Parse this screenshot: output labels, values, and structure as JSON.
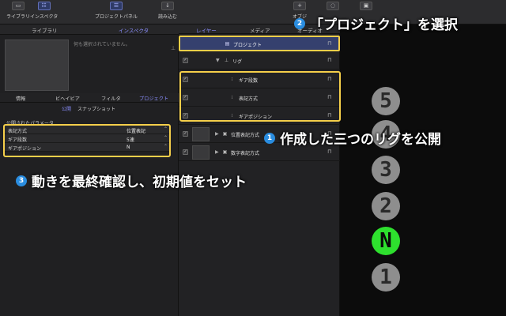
{
  "toolbar": {
    "buttons": [
      {
        "label": "ライブラリ",
        "icon": "library-icon"
      },
      {
        "label": "インスペクタ",
        "icon": "inspector-icon"
      },
      {
        "label": "プロジェクトパネル",
        "icon": "project-panel-icon"
      },
      {
        "label": "読み込む",
        "icon": "import-icon"
      },
      {
        "label": "オブジ",
        "icon": "add-object-icon"
      },
      {
        "label": "",
        "icon": "behaviors-icon"
      },
      {
        "label": "",
        "icon": "shape-icon"
      }
    ]
  },
  "left_panel": {
    "tabs": [
      "ライブラリ",
      "インスペクタ"
    ],
    "active_tab": "インスペクタ",
    "preview_message": "何も選択されていません。",
    "inspector_tabs": [
      "情報",
      "ビヘイビア",
      "フィルタ",
      "プロジェクト"
    ],
    "active_inspector_tab": "プロジェクト",
    "sub_tabs": [
      "公開",
      "スナップショット"
    ],
    "active_sub_tab": "公開",
    "published_header": "公開されたパラメータ",
    "params": [
      {
        "name": "表記方式",
        "value": "位置表記"
      },
      {
        "name": "ギア段数",
        "value": "5速"
      },
      {
        "name": "ギアポジション",
        "value": "N"
      }
    ]
  },
  "layers_panel": {
    "tabs": [
      "レイヤー",
      "メディア",
      "オーディオ"
    ],
    "active_tab": "レイヤー",
    "project_row": "プロジェクト",
    "rig_row": "リグ",
    "rig_children": [
      "ギア段数",
      "表記方式",
      "ギアポジション"
    ],
    "groups": [
      "位置表記方式",
      "数字表記方式"
    ]
  },
  "canvas": {
    "gears": [
      "5",
      "4",
      "3",
      "2",
      "N",
      "1"
    ],
    "active_gear": "N",
    "active_color": "#2ee02e"
  },
  "annotations": {
    "step1": {
      "num": "1",
      "text": "作成した三つのリグを公開"
    },
    "step2": {
      "num": "2",
      "text": "「プロジェクト」を選択"
    },
    "step3": {
      "num": "3",
      "text": "動きを最終確認し、初期値をセット"
    },
    "highlight_color": "#f5cf4a",
    "badge_color": "#2a8de0"
  }
}
